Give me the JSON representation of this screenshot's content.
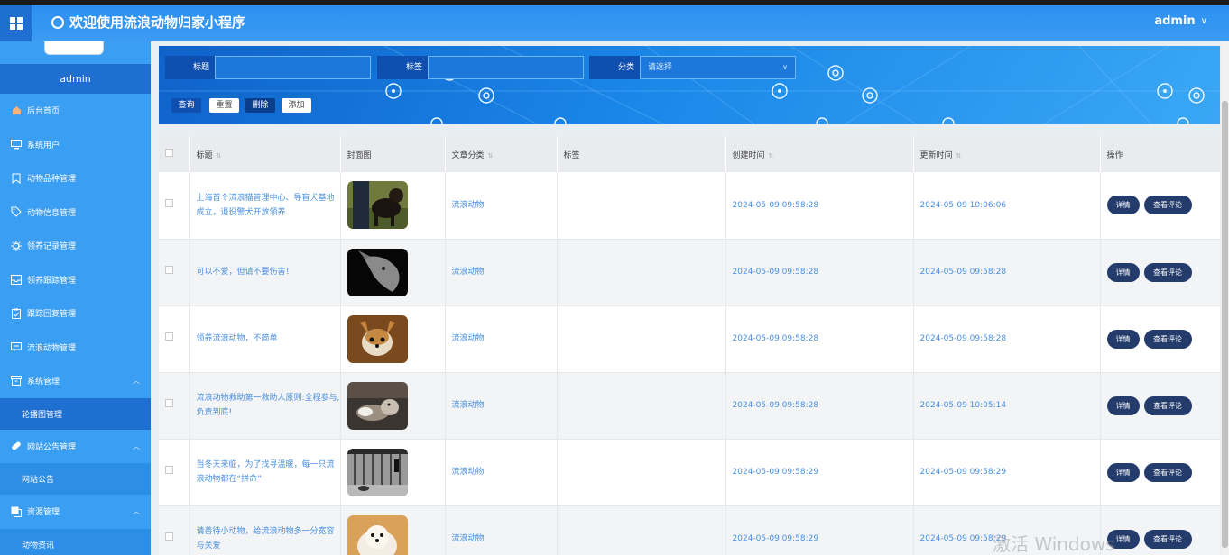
{
  "app": {
    "title": "欢迎使用流浪动物归家小程序",
    "user": "admin",
    "chevron": "∨"
  },
  "sidebar": {
    "user": "admin",
    "items": [
      {
        "label": "后台首页",
        "icon": "home-icon"
      },
      {
        "label": "系统用户",
        "icon": "monitor-icon"
      },
      {
        "label": "动物品种管理",
        "icon": "bookmark-icon"
      },
      {
        "label": "动物信息管理",
        "icon": "tag-icon"
      },
      {
        "label": "领养记录管理",
        "icon": "gear-icon"
      },
      {
        "label": "领养跟踪管理",
        "icon": "inbox-icon"
      },
      {
        "label": "跟踪回复管理",
        "icon": "clipboard-icon"
      },
      {
        "label": "流浪动物管理",
        "icon": "chat-icon"
      },
      {
        "label": "系统管理",
        "icon": "archive-icon",
        "expanded": true
      },
      {
        "label": "网站公告管理",
        "icon": "pill-icon",
        "expanded": true
      },
      {
        "label": "资源管理",
        "icon": "copy-icon",
        "expanded": true
      }
    ],
    "subs": {
      "system": "轮播图管理",
      "notice": "网站公告",
      "resource": "动物资讯"
    }
  },
  "filters": {
    "title_label": "标题",
    "title_value": "",
    "tag_label": "标签",
    "tag_value": "",
    "category_label": "分类",
    "category_placeholder": "请选择"
  },
  "buttons": {
    "query": "查询",
    "reset": "重置",
    "delete": "删除",
    "add": "添加"
  },
  "table": {
    "headers": {
      "title": "标题",
      "cover": "封面图",
      "category": "文章分类",
      "tags": "标签",
      "created": "创建时间",
      "updated": "更新时间",
      "ops": "操作"
    },
    "op_detail": "详情",
    "op_comments": "查看评论",
    "rows": [
      {
        "title": "上海首个流浪猫管理中心、导盲犬基地成立，退役警犬开放领养",
        "category": "流浪动物",
        "tags": "",
        "created": "2024-05-09 09:58:28",
        "updated": "2024-05-09 10:06:06"
      },
      {
        "title": "可以不爱，但请不要伤害！",
        "category": "流浪动物",
        "tags": "",
        "created": "2024-05-09 09:58:28",
        "updated": "2024-05-09 09:58:28"
      },
      {
        "title": "领养流浪动物，不简单",
        "category": "流浪动物",
        "tags": "",
        "created": "2024-05-09 09:58:28",
        "updated": "2024-05-09 09:58:28"
      },
      {
        "title": "流浪动物救助第一救助人原则:全程参与,负责到底!",
        "category": "流浪动物",
        "tags": "",
        "created": "2024-05-09 09:58:28",
        "updated": "2024-05-09 10:05:14"
      },
      {
        "title": "当冬天来临，为了找寻温暖，每一只流浪动物都在“拼命”",
        "category": "流浪动物",
        "tags": "",
        "created": "2024-05-09 09:58:29",
        "updated": "2024-05-09 09:58:29"
      },
      {
        "title": "请善待小动物，给流浪动物多一分宽容与关爱",
        "category": "流浪动物",
        "tags": "",
        "created": "2024-05-09 09:58:29",
        "updated": "2024-05-09 09:58:29"
      }
    ]
  },
  "watermark": "激活 Windows",
  "colors": {
    "accent": "#3a9ef2",
    "dark": "#1f6fd1",
    "link": "#4a8fe0",
    "op": "#233c6b"
  }
}
